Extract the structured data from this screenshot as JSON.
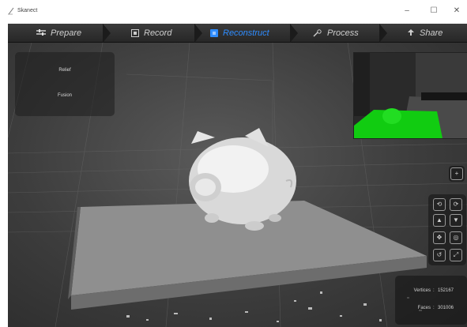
{
  "window": {
    "title": "Skanect",
    "controls": {
      "minimize": "–",
      "maximize": "☐",
      "close": "✕"
    }
  },
  "tabs": [
    {
      "label": "Prepare",
      "icon": "prepare-icon",
      "active": false
    },
    {
      "label": "Record",
      "icon": "record-icon",
      "active": false
    },
    {
      "label": "Reconstruct",
      "icon": "reconstruct-icon",
      "active": true
    },
    {
      "label": "Process",
      "icon": "process-icon",
      "active": false
    },
    {
      "label": "Share",
      "icon": "share-icon",
      "active": false
    }
  ],
  "info_panel": {
    "line1": "Relief",
    "line2": "Fusion"
  },
  "stats": {
    "vertices_label": "Vertices",
    "vertices_value": "152167",
    "faces_label": "Faces",
    "faces_value": "301006"
  },
  "colors": {
    "active_tab": "#2e8cff",
    "preview_mesh": "#22cc22",
    "background": "#3d3d3d"
  }
}
